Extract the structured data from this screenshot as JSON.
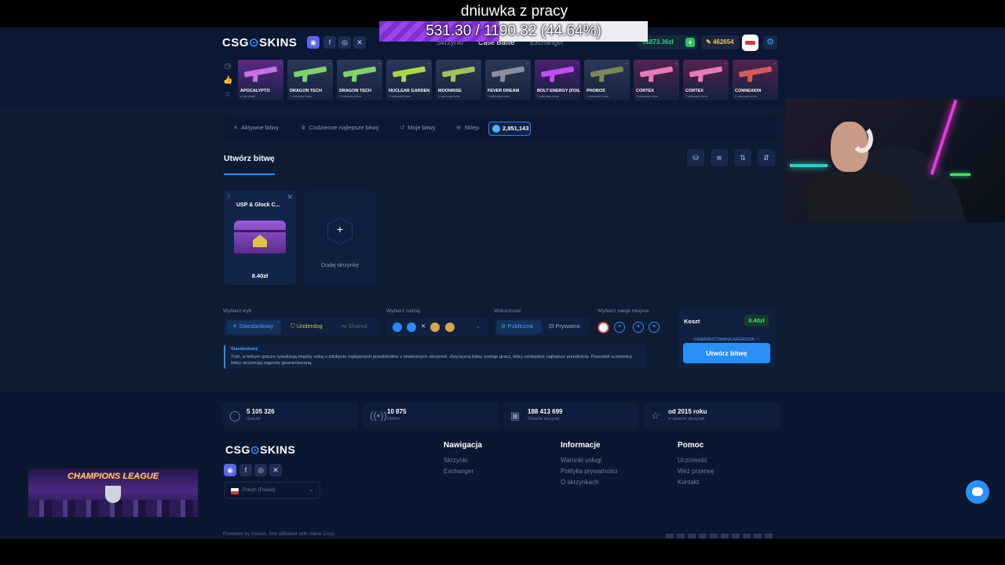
{
  "overlay": {
    "stream_title": "dniuwka z pracy",
    "progress_text": "531.30 / 1190.32 (44.64%)",
    "progress_fraction": 0.4464
  },
  "header": {
    "logo_left": "CSG",
    "logo_right": "SKINS",
    "nav": [
      "Skrzynki",
      "Case Battle",
      "Exchanger"
    ],
    "balance": "51873.36zł",
    "coins": "462654"
  },
  "live_drops": [
    {
      "name": "APOCALYPTO",
      "sub": "w tej chwili",
      "bg": "#5b2a86",
      "gun": "#c86fe6"
    },
    {
      "name": "DRAGON TECH",
      "sub": "1 sekundy temu",
      "bg": "#2b3858",
      "gun": "#7fd36a"
    },
    {
      "name": "DRAGON TECH",
      "sub": "1 sekundy temu",
      "bg": "#2b3858",
      "gun": "#7fd36a"
    },
    {
      "name": "NUCLEAR GARDEN",
      "sub": "1 sekundy temu",
      "bg": "#2b3858",
      "gun": "#a8d84a"
    },
    {
      "name": "MOONRISE",
      "sub": "1 sekundy temu",
      "bg": "#2b3858",
      "gun": "#9fc25a"
    },
    {
      "name": "FEVER DREAM",
      "sub": "1 sekundy temu",
      "bg": "#2b3858",
      "gun": "#8a8f9a"
    },
    {
      "name": "BOLT ENERGY (FOIL)",
      "sub": "1 sekundy temu",
      "bg": "#4a2070",
      "gun": "#c14ef0"
    },
    {
      "name": "PHOBOS",
      "sub": "1 sekundy temu",
      "bg": "#2b3858",
      "gun": "#7b8a55"
    },
    {
      "name": "CORTEX",
      "sub": "1 sekundy temu",
      "bg": "#52234f",
      "gun": "#e87ab8"
    },
    {
      "name": "CORTEX",
      "sub": "1 sekundy temu",
      "bg": "#52234f",
      "gun": "#e87ab8"
    },
    {
      "name": "CONNEXION",
      "sub": "6 sekundy temu",
      "bg": "#52234f",
      "gun": "#d65a5a"
    }
  ],
  "tabs": {
    "active_battles": "Aktywne bitwy",
    "daily_best": "Codzienne najlepsze bitwy",
    "my_battles": "Moje bitwy",
    "shop": "Sklep",
    "gems": "2,851,143"
  },
  "create": {
    "title": "Utwórz bitwę",
    "case_name": "USP & Glock C...",
    "case_price": "8.40zł",
    "add_case": "Dodaj skrzynkę"
  },
  "settings": {
    "mode_label": "Wybierz tryb",
    "mode_standard": "Standardowy",
    "mode_underdog": "Underdog",
    "mode_shared": "Shared",
    "type_label": "Wybierz rodzaj",
    "visibility_label": "Widoczność",
    "vis_public": "Publiczna",
    "vis_private": "Prywatna",
    "seat_label": "Wybierz swoje miejsce"
  },
  "cost": {
    "label": "Koszt",
    "value": "8.40zł",
    "guaranteed": "GWARANTOWANA NAGRODA ⓘ",
    "button": "Utwórz bitwę"
  },
  "mode_description": {
    "title": "Standardowy",
    "text": "Tryb, w którym gracze rywalizują między sobą o zdobycie najlepszych przedmiotów z otwieranych skrzynek. Zwycięzcą bitwy zostaje gracz, który zdobędzie najlepsze przedmioty. Pozostali uczestnicy bitwy otrzymują nagrodę gwarantowaną."
  },
  "stats": [
    {
      "icon": "◯",
      "value": "5 105 326",
      "label": "Gracze"
    },
    {
      "icon": "((•))",
      "value": "10 875",
      "label": "Online"
    },
    {
      "icon": "▣",
      "value": "188 413 699",
      "label": "Otwarte skrzynki"
    },
    {
      "icon": "☆",
      "value": "od 2015 roku",
      "label": "w świecie skrzynek"
    }
  ],
  "footer": {
    "nav_title": "Nawigacja",
    "nav_items": [
      "Skrzynki",
      "Exchanger"
    ],
    "info_title": "Informacje",
    "info_items": [
      "Warunki usługi",
      "Polityka prywatności",
      "O skrzynkach"
    ],
    "help_title": "Pomoc",
    "help_items": [
      "Uczciwość",
      "Weź przerwę",
      "Kontakt"
    ],
    "language": "Polish (Polski)",
    "powered": "Powered by Steam. Not affiliated with Valve Corp."
  },
  "banner": {
    "text": "CHAMPIONS LEAGUE"
  },
  "colors": {
    "accent": "#2e8bf5",
    "background": "#0d1b33",
    "balance_green": "#33d17a"
  }
}
